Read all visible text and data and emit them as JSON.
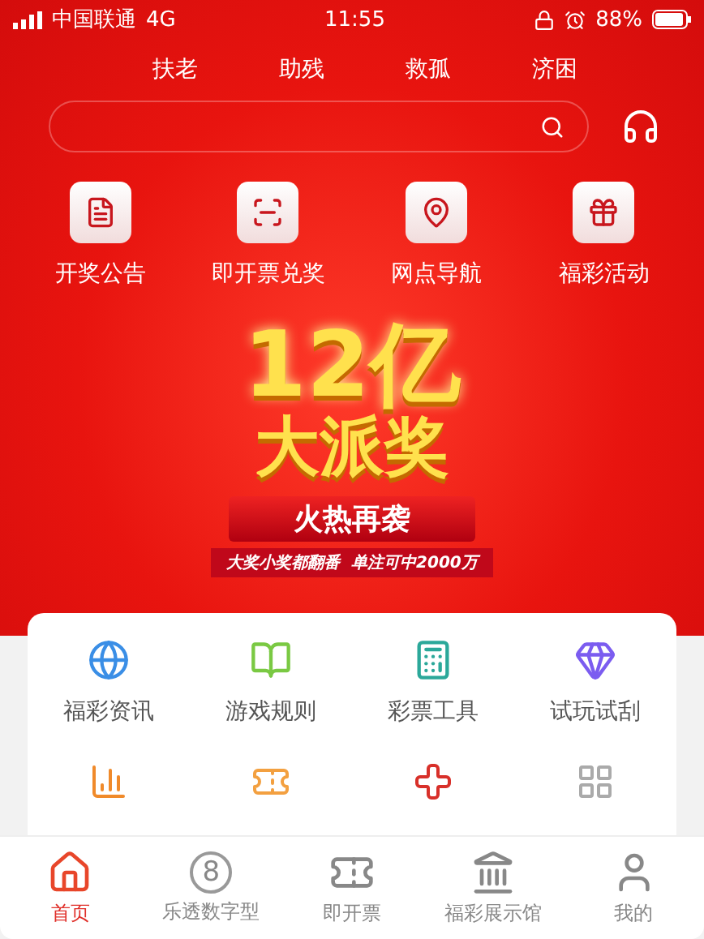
{
  "status_bar": {
    "carrier": "中国联通",
    "network": "4G",
    "time": "11:55",
    "battery": "88%"
  },
  "top_links": [
    "扶老",
    "助残",
    "救孤",
    "济困"
  ],
  "quick_actions": [
    "开奖公告",
    "即开票兑奖",
    "网点导航",
    "福彩活动"
  ],
  "banner": {
    "headline": "12亿",
    "title": "大派奖",
    "ribbon": "火热再袭",
    "subtitle": "大奖小奖都翻番  单注可中2000万"
  },
  "services": [
    {
      "label": "福彩资讯"
    },
    {
      "label": "游戏规则"
    },
    {
      "label": "彩票工具"
    },
    {
      "label": "试玩试刮"
    }
  ],
  "tab_bar": [
    {
      "label": "首页",
      "selected": true
    },
    {
      "label": "乐透数字型",
      "selected": false,
      "badge": "8"
    },
    {
      "label": "即开票",
      "selected": false
    },
    {
      "label": "福彩展示馆",
      "selected": false
    },
    {
      "label": "我的",
      "selected": false
    }
  ]
}
